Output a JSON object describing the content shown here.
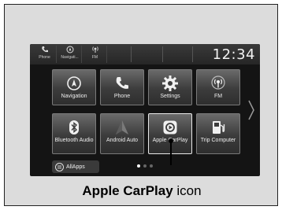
{
  "topbar": {
    "items": [
      {
        "label": "Phone",
        "icon": "phone-icon"
      },
      {
        "label": "Navigati...",
        "icon": "navigation-icon"
      },
      {
        "label": "FM",
        "icon": "radio-icon"
      }
    ],
    "clock": "12:34"
  },
  "tiles": [
    {
      "label": "Navigation",
      "icon": "navigation-icon"
    },
    {
      "label": "Phone",
      "icon": "phone-icon"
    },
    {
      "label": "Settings",
      "icon": "gear-icon"
    },
    {
      "label": "FM",
      "icon": "radio-icon"
    },
    {
      "label": "Bluetooth Audio",
      "icon": "bluetooth-icon"
    },
    {
      "label": "Android Auto",
      "icon": "android-auto-icon"
    },
    {
      "label": "Apple CarPlay",
      "icon": "carplay-icon"
    },
    {
      "label": "Trip Computer",
      "icon": "fuel-pump-icon"
    }
  ],
  "allapps": {
    "label": "AllApps"
  },
  "page_indicator": {
    "count": 3,
    "active": 1
  },
  "caption": {
    "bold": "Apple CarPlay",
    "rest": " icon"
  }
}
